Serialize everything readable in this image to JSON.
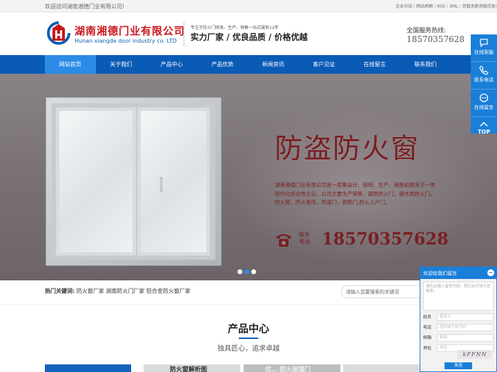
{
  "topbar": {
    "welcome": "欢迎访问湖南湘德门业有限公司!",
    "links": [
      "企业分站",
      "网站地图",
      "RSS",
      "XML",
      "您暂无新询盘信息!"
    ]
  },
  "header": {
    "logo_cn": "湖南湘德门业有限公司",
    "logo_en": "Hunan xiangde door industry co. LTD",
    "slogan_small": "专注于防火门研发、生产、销售一站式服务12年",
    "slogan_big": "实力厂家 / 优良品质 / 价格优越",
    "hotline_label": "全国服务热线:",
    "hotline_number": "18570357628"
  },
  "nav": {
    "items": [
      "网站首页",
      "关于我们",
      "产品中心",
      "产品优势",
      "新闻资讯",
      "客户见证",
      "在线留言",
      "联系我们"
    ],
    "active_index": 0
  },
  "banner": {
    "title": "防盗防火窗",
    "description": "湖南湘德门业有限公司是一家集设计、研制、生产、销售和服务于一体现代化综合性企业。公司主要生产销售，钢质防火门，钢木质防火门，防火窗，防火卷帘，防盗门，钢质门,防火入户门。",
    "contact_label": "联系电话",
    "phone": "18570357628",
    "slide_count": 3,
    "active_slide": 1
  },
  "keywords": {
    "label": "热门关键词:",
    "items": [
      "防火窗厂家",
      "湖南防火门厂家",
      "铝合金防火窗厂家"
    ],
    "search_placeholder": "请输入您要搜索的关键词"
  },
  "products": {
    "title": "产品中心",
    "subtitle": "独具匠心，追求卓越",
    "card_labels": [
      "防火窗解析图",
      "优… 防火玻璃门"
    ]
  },
  "float_bar": {
    "items": [
      "在线客服",
      "联系电话",
      "在线留言",
      "TOP"
    ]
  },
  "message": {
    "title": "欢迎给我们留言",
    "content_placeholder": "请在此输入留言内容，我们会尽快与您联系。",
    "fields": [
      {
        "label": "姓名",
        "placeholder": "联系人"
      },
      {
        "label": "电话",
        "placeholder": "座机或手机号码"
      },
      {
        "label": "邮箱",
        "placeholder": "邮箱"
      },
      {
        "label": "地址",
        "placeholder": "地址"
      }
    ],
    "captcha": "kFFNN",
    "send_label": "发送"
  },
  "colors": {
    "brand_blue": "#0a5bb6",
    "brand_red": "#c8161d",
    "banner_text": "#7a1e22"
  }
}
